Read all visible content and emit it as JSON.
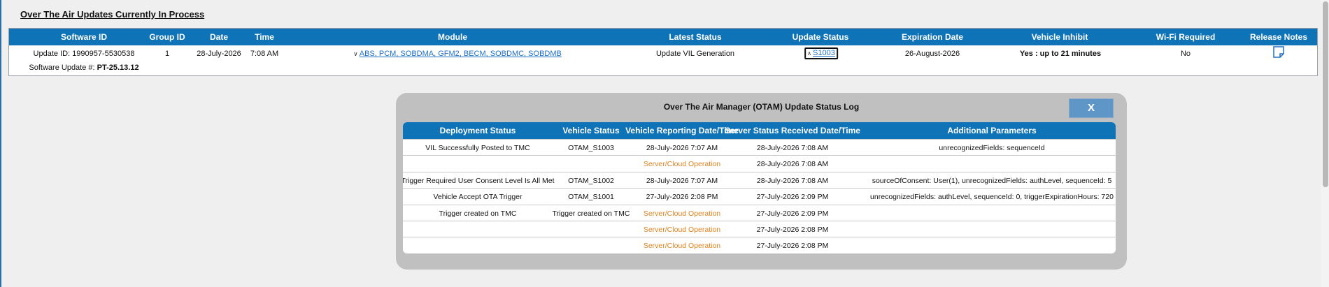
{
  "page_title": "Over The Air Updates Currently In Process",
  "updates_table": {
    "headers": {
      "software_id": "Software ID",
      "group_id": "Group ID",
      "date": "Date",
      "time": "Time",
      "module": "Module",
      "latest_status": "Latest Status",
      "update_status": "Update Status",
      "expiration_date": "Expiration Date",
      "vehicle_inhibit": "Vehicle Inhibit",
      "wifi_required": "Wi-Fi Required",
      "release_notes": "Release Notes"
    },
    "row": {
      "update_id_label": "Update ID:",
      "update_id_value": "1990957-5530538",
      "software_update_label": "Software Update #:",
      "software_update_value": "PT-25.13.12",
      "group_id": "1",
      "date": "28-July-2026",
      "time": "7:08 AM",
      "module": "ABS, PCM, SOBDMA, GFM2, BECM, SOBDMC, SOBDMB",
      "latest_status": "Update VIL Generation",
      "update_status": "S1003",
      "expiration_date": "26-August-2026",
      "vehicle_inhibit_prefix": "Yes :",
      "vehicle_inhibit_value": "up to 21 minutes",
      "wifi_required": "No",
      "release_notes_icon": "document-icon"
    }
  },
  "dialog": {
    "title": "Over The Air Manager (OTAM) Update Status Log",
    "close_label": "X",
    "headers": {
      "deployment_status": "Deployment Status",
      "vehicle_status": "Vehicle Status",
      "vehicle_reporting": "Vehicle Reporting Date/Time",
      "server_received": "Server Status Received Date/Time",
      "additional_parameters": "Additional Parameters"
    },
    "rows": [
      {
        "deployment_status": "VIL Successfully Posted to TMC",
        "vehicle_status": "OTAM_S1003",
        "vehicle_reporting": "28-July-2026 7:07 AM",
        "server_received": "28-July-2026 7:08 AM",
        "additional_parameters": "unrecognizedFields: sequenceId"
      },
      {
        "deployment_status": "",
        "vehicle_status": "",
        "vehicle_reporting": "Server/Cloud Operation",
        "server_received": "28-July-2026 7:08 AM",
        "additional_parameters": ""
      },
      {
        "deployment_status": "Trigger Required User Consent Level Is All Met",
        "vehicle_status": "OTAM_S1002",
        "vehicle_reporting": "28-July-2026 7:07 AM",
        "server_received": "28-July-2026 7:08 AM",
        "additional_parameters": "sourceOfConsent: User(1),  unrecognizedFields: authLevel,  sequenceId: 5"
      },
      {
        "deployment_status": "Vehicle Accept OTA Trigger",
        "vehicle_status": "OTAM_S1001",
        "vehicle_reporting": "27-July-2026 2:08 PM",
        "server_received": "27-July-2026 2:09 PM",
        "additional_parameters": "unrecognizedFields: authLevel,  sequenceId: 0,  triggerExpirationHours: 720"
      },
      {
        "deployment_status": "Trigger created on TMC",
        "vehicle_status": "Trigger created on TMC",
        "vehicle_reporting": "Server/Cloud Operation",
        "server_received": "27-July-2026 2:09 PM",
        "additional_parameters": ""
      },
      {
        "deployment_status": "",
        "vehicle_status": "",
        "vehicle_reporting": "Server/Cloud Operation",
        "server_received": "27-July-2026 2:08 PM",
        "additional_parameters": ""
      },
      {
        "deployment_status": "",
        "vehicle_status": "",
        "vehicle_reporting": "Server/Cloud Operation",
        "server_received": "27-July-2026 2:08 PM",
        "additional_parameters": ""
      }
    ],
    "server_cloud_color": "#e0821e"
  },
  "colors": {
    "header_blue": "#0f73b8",
    "link_blue": "#1f6fc5",
    "dialog_gray": "#c0c0c0",
    "close_button": "#5f96c8"
  }
}
